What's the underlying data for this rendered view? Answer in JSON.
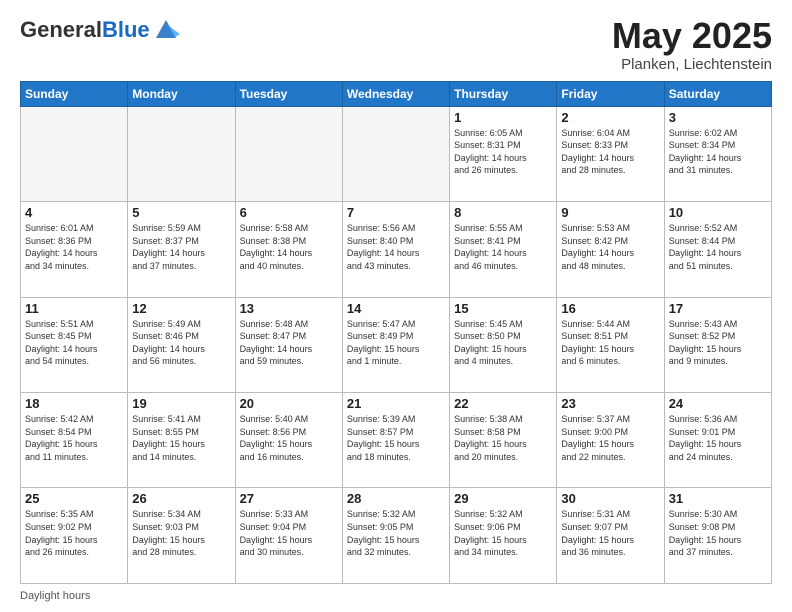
{
  "header": {
    "logo_general": "General",
    "logo_blue": "Blue",
    "month_title": "May 2025",
    "location": "Planken, Liechtenstein"
  },
  "days_of_week": [
    "Sunday",
    "Monday",
    "Tuesday",
    "Wednesday",
    "Thursday",
    "Friday",
    "Saturday"
  ],
  "weeks": [
    [
      {
        "num": "",
        "info": ""
      },
      {
        "num": "",
        "info": ""
      },
      {
        "num": "",
        "info": ""
      },
      {
        "num": "",
        "info": ""
      },
      {
        "num": "1",
        "info": "Sunrise: 6:05 AM\nSunset: 8:31 PM\nDaylight: 14 hours\nand 26 minutes."
      },
      {
        "num": "2",
        "info": "Sunrise: 6:04 AM\nSunset: 8:33 PM\nDaylight: 14 hours\nand 28 minutes."
      },
      {
        "num": "3",
        "info": "Sunrise: 6:02 AM\nSunset: 8:34 PM\nDaylight: 14 hours\nand 31 minutes."
      }
    ],
    [
      {
        "num": "4",
        "info": "Sunrise: 6:01 AM\nSunset: 8:36 PM\nDaylight: 14 hours\nand 34 minutes."
      },
      {
        "num": "5",
        "info": "Sunrise: 5:59 AM\nSunset: 8:37 PM\nDaylight: 14 hours\nand 37 minutes."
      },
      {
        "num": "6",
        "info": "Sunrise: 5:58 AM\nSunset: 8:38 PM\nDaylight: 14 hours\nand 40 minutes."
      },
      {
        "num": "7",
        "info": "Sunrise: 5:56 AM\nSunset: 8:40 PM\nDaylight: 14 hours\nand 43 minutes."
      },
      {
        "num": "8",
        "info": "Sunrise: 5:55 AM\nSunset: 8:41 PM\nDaylight: 14 hours\nand 46 minutes."
      },
      {
        "num": "9",
        "info": "Sunrise: 5:53 AM\nSunset: 8:42 PM\nDaylight: 14 hours\nand 48 minutes."
      },
      {
        "num": "10",
        "info": "Sunrise: 5:52 AM\nSunset: 8:44 PM\nDaylight: 14 hours\nand 51 minutes."
      }
    ],
    [
      {
        "num": "11",
        "info": "Sunrise: 5:51 AM\nSunset: 8:45 PM\nDaylight: 14 hours\nand 54 minutes."
      },
      {
        "num": "12",
        "info": "Sunrise: 5:49 AM\nSunset: 8:46 PM\nDaylight: 14 hours\nand 56 minutes."
      },
      {
        "num": "13",
        "info": "Sunrise: 5:48 AM\nSunset: 8:47 PM\nDaylight: 14 hours\nand 59 minutes."
      },
      {
        "num": "14",
        "info": "Sunrise: 5:47 AM\nSunset: 8:49 PM\nDaylight: 15 hours\nand 1 minute."
      },
      {
        "num": "15",
        "info": "Sunrise: 5:45 AM\nSunset: 8:50 PM\nDaylight: 15 hours\nand 4 minutes."
      },
      {
        "num": "16",
        "info": "Sunrise: 5:44 AM\nSunset: 8:51 PM\nDaylight: 15 hours\nand 6 minutes."
      },
      {
        "num": "17",
        "info": "Sunrise: 5:43 AM\nSunset: 8:52 PM\nDaylight: 15 hours\nand 9 minutes."
      }
    ],
    [
      {
        "num": "18",
        "info": "Sunrise: 5:42 AM\nSunset: 8:54 PM\nDaylight: 15 hours\nand 11 minutes."
      },
      {
        "num": "19",
        "info": "Sunrise: 5:41 AM\nSunset: 8:55 PM\nDaylight: 15 hours\nand 14 minutes."
      },
      {
        "num": "20",
        "info": "Sunrise: 5:40 AM\nSunset: 8:56 PM\nDaylight: 15 hours\nand 16 minutes."
      },
      {
        "num": "21",
        "info": "Sunrise: 5:39 AM\nSunset: 8:57 PM\nDaylight: 15 hours\nand 18 minutes."
      },
      {
        "num": "22",
        "info": "Sunrise: 5:38 AM\nSunset: 8:58 PM\nDaylight: 15 hours\nand 20 minutes."
      },
      {
        "num": "23",
        "info": "Sunrise: 5:37 AM\nSunset: 9:00 PM\nDaylight: 15 hours\nand 22 minutes."
      },
      {
        "num": "24",
        "info": "Sunrise: 5:36 AM\nSunset: 9:01 PM\nDaylight: 15 hours\nand 24 minutes."
      }
    ],
    [
      {
        "num": "25",
        "info": "Sunrise: 5:35 AM\nSunset: 9:02 PM\nDaylight: 15 hours\nand 26 minutes."
      },
      {
        "num": "26",
        "info": "Sunrise: 5:34 AM\nSunset: 9:03 PM\nDaylight: 15 hours\nand 28 minutes."
      },
      {
        "num": "27",
        "info": "Sunrise: 5:33 AM\nSunset: 9:04 PM\nDaylight: 15 hours\nand 30 minutes."
      },
      {
        "num": "28",
        "info": "Sunrise: 5:32 AM\nSunset: 9:05 PM\nDaylight: 15 hours\nand 32 minutes."
      },
      {
        "num": "29",
        "info": "Sunrise: 5:32 AM\nSunset: 9:06 PM\nDaylight: 15 hours\nand 34 minutes."
      },
      {
        "num": "30",
        "info": "Sunrise: 5:31 AM\nSunset: 9:07 PM\nDaylight: 15 hours\nand 36 minutes."
      },
      {
        "num": "31",
        "info": "Sunrise: 5:30 AM\nSunset: 9:08 PM\nDaylight: 15 hours\nand 37 minutes."
      }
    ]
  ],
  "footer": {
    "daylight_label": "Daylight hours"
  }
}
